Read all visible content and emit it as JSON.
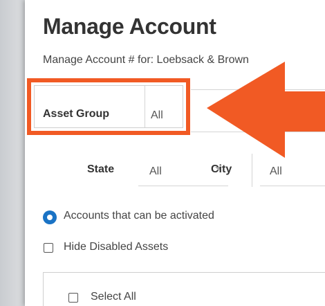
{
  "modal": {
    "title": "Manage Account",
    "subtitle": "Manage Account # for: Loebsack & Brown"
  },
  "filters": {
    "asset_group_label": "Asset Group",
    "asset_group_value": "All",
    "state_label": "State",
    "state_value": "All",
    "city_label": "City",
    "city_value": "All"
  },
  "options": {
    "radio_label": "Accounts that can be activated",
    "hide_disabled_label": "Hide Disabled Assets",
    "select_all_label": "Select All"
  },
  "colors": {
    "highlight": "#f15a24",
    "radio": "#1a73c5"
  },
  "icons": {
    "annotation": "arrow-left-icon",
    "dropdown": "chevron-down-icon"
  }
}
